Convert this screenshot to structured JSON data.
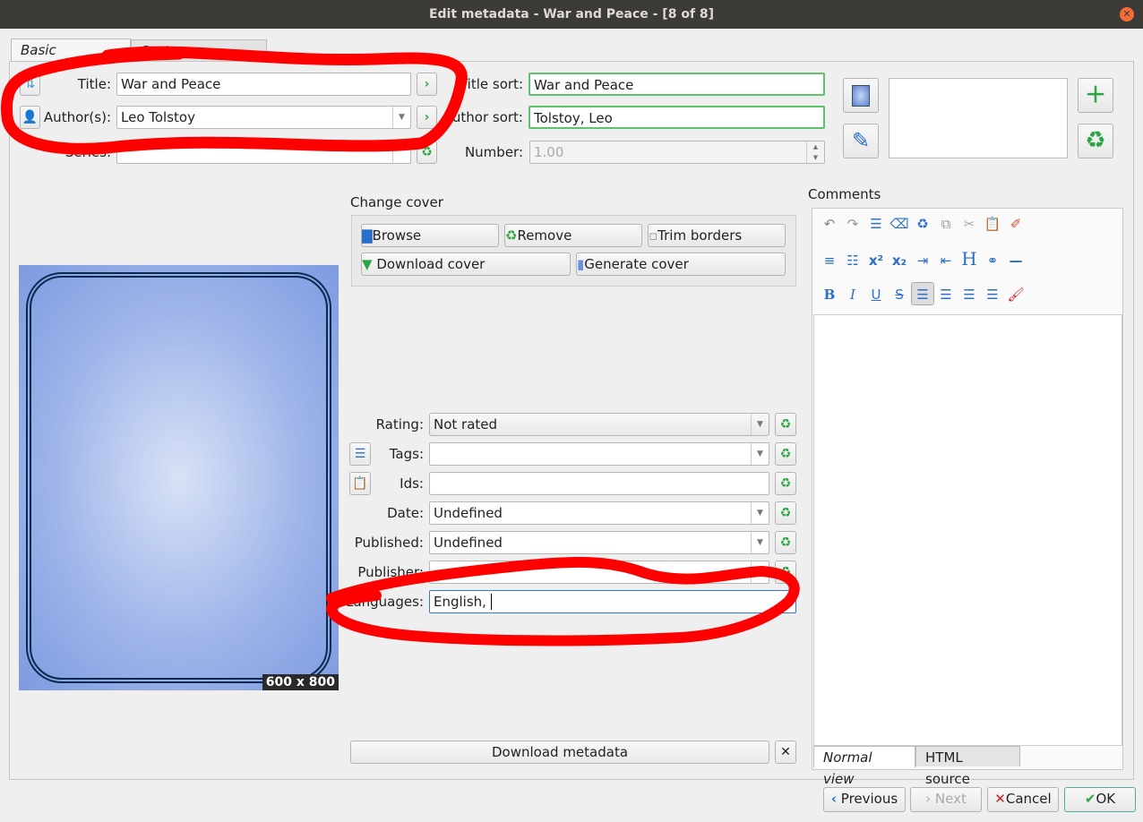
{
  "window": {
    "title": "Edit metadata - War and Peace -  [8 of 8]"
  },
  "tabs": [
    {
      "label": "Basic metadata",
      "active": true
    },
    {
      "label": "Custom metadata",
      "active": false
    }
  ],
  "fields": {
    "title": {
      "label": "Title:",
      "value": "War and Peace"
    },
    "author": {
      "label": "Author(s):",
      "value": "Leo Tolstoy"
    },
    "series": {
      "label": "Series:",
      "value": ""
    },
    "title_sort": {
      "label": "Title sort:",
      "value": "War and Peace"
    },
    "author_sort": {
      "label": "Author sort:",
      "value": "Tolstoy, Leo"
    },
    "number": {
      "label": "Number:",
      "value": "1.00"
    },
    "rating": {
      "label": "Rating:",
      "value": "Not rated"
    },
    "tags": {
      "label": "Tags:",
      "value": ""
    },
    "ids": {
      "label": "Ids:",
      "value": ""
    },
    "date": {
      "label": "Date:",
      "value": "Undefined"
    },
    "published": {
      "label": "Published:",
      "value": "Undefined"
    },
    "publisher": {
      "label": "Publisher:",
      "value": ""
    },
    "languages": {
      "label": "Languages:",
      "value": "English, "
    }
  },
  "cover": {
    "size_label": "600 x 800",
    "group_label": "Change cover",
    "buttons": {
      "browse": "Browse",
      "remove": "Remove",
      "trim": "Trim borders",
      "download": "Download cover",
      "generate": "Generate cover"
    }
  },
  "download_metadata": "Download metadata",
  "comments": {
    "label": "Comments",
    "tabs": [
      "Normal view",
      "HTML source"
    ]
  },
  "footer": {
    "previous": "Previous",
    "next": "Next",
    "cancel": "Cancel",
    "ok": "OK"
  },
  "annotation_color": "#ff0000"
}
